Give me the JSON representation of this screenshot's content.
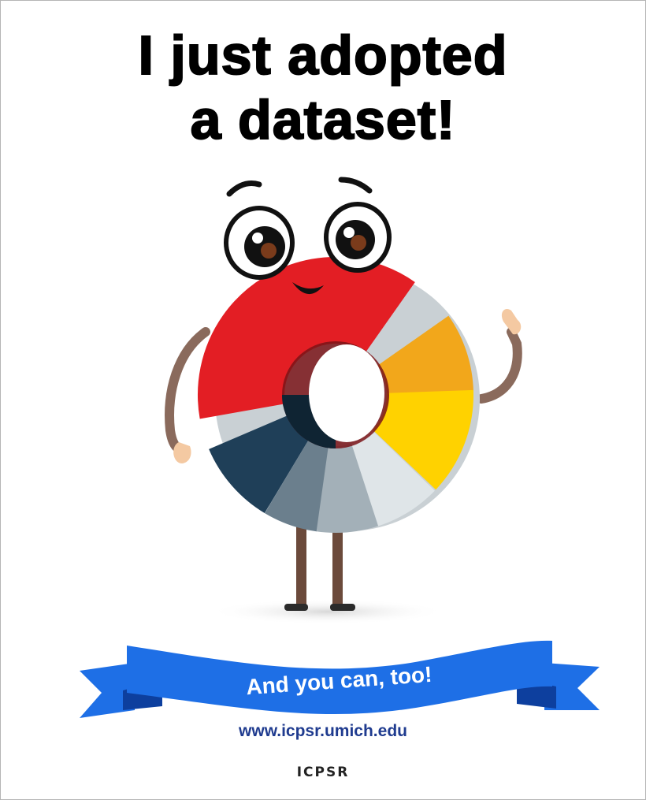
{
  "headline": {
    "line1": "I just adopted",
    "line2": "a dataset!"
  },
  "ribbon": {
    "text": "And you can, too!",
    "color": "#1e6fe6",
    "dark_color": "#0d3f9e"
  },
  "url": "www.icpsr.umich.edu",
  "logo": "ICPSR",
  "mascot": {
    "icon": "donut-chart-mascot-icon",
    "segment_colors": [
      "#e31e24",
      "#f2a71b",
      "#ffd200",
      "#1f3f58",
      "#6b7f8d",
      "#a3b0b8",
      "#dfe5e8"
    ]
  }
}
